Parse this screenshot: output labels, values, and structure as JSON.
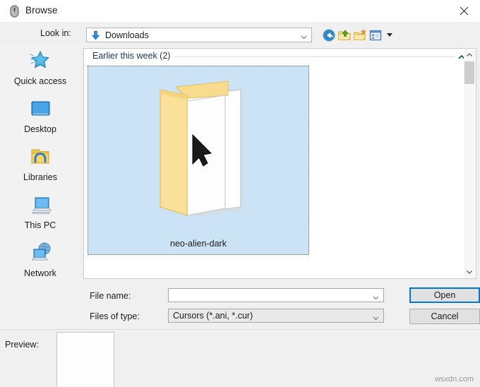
{
  "window": {
    "title": "Browse",
    "title_icon": "mouse-cursor-icon",
    "close_label": "✕"
  },
  "toolbar": {
    "lookin_label": "Look in:",
    "lookin_value": "Downloads",
    "lookin_icon": "downloads-arrow-icon",
    "buttons": [
      {
        "name": "back-button",
        "icon": "back-arrow-icon",
        "tooltip": "Back"
      },
      {
        "name": "up-one-level-button",
        "icon": "folder-up-icon",
        "tooltip": "Up One Level"
      },
      {
        "name": "new-folder-button",
        "icon": "new-folder-icon",
        "tooltip": "Create New Folder"
      },
      {
        "name": "views-button",
        "icon": "views-icon",
        "tooltip": "Views"
      }
    ]
  },
  "places": {
    "items": [
      {
        "label": "Quick access",
        "icon": "star-icon"
      },
      {
        "label": "Desktop",
        "icon": "monitor-icon"
      },
      {
        "label": "Libraries",
        "icon": "libraries-folder-icon"
      },
      {
        "label": "This PC",
        "icon": "laptop-icon"
      },
      {
        "label": "Network",
        "icon": "network-globe-icon"
      }
    ]
  },
  "filelist": {
    "group_header": "Earlier this week (2)",
    "group_chevron": "chevron-up-icon",
    "items": [
      {
        "label": "neo-alien-dark",
        "icon": "folder-cursor-thumbnail",
        "selected": true
      }
    ]
  },
  "form": {
    "filename_label": "File name:",
    "filename_value": "",
    "filename_placeholder": "",
    "filetype_label": "Files of type:",
    "filetype_value": "Cursors (*.ani, *.cur)",
    "open_label": "Open",
    "cancel_label": "Cancel"
  },
  "preview": {
    "label": "Preview:",
    "content": ""
  },
  "watermark": "wsxdn.com",
  "colors": {
    "accent": "#0078d7",
    "selection": "#cce3f6",
    "group_text": "#22355e",
    "dialog_bg": "#f0f0f0"
  }
}
